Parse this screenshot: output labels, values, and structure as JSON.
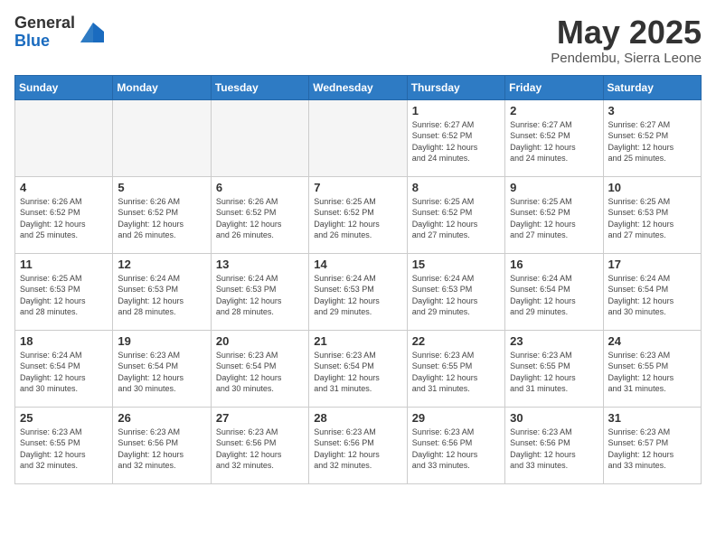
{
  "header": {
    "logo_general": "General",
    "logo_blue": "Blue",
    "month_year": "May 2025",
    "location": "Pendembu, Sierra Leone"
  },
  "weekdays": [
    "Sunday",
    "Monday",
    "Tuesday",
    "Wednesday",
    "Thursday",
    "Friday",
    "Saturday"
  ],
  "weeks": [
    [
      {
        "day": "",
        "info": ""
      },
      {
        "day": "",
        "info": ""
      },
      {
        "day": "",
        "info": ""
      },
      {
        "day": "",
        "info": ""
      },
      {
        "day": "1",
        "info": "Sunrise: 6:27 AM\nSunset: 6:52 PM\nDaylight: 12 hours\nand 24 minutes."
      },
      {
        "day": "2",
        "info": "Sunrise: 6:27 AM\nSunset: 6:52 PM\nDaylight: 12 hours\nand 24 minutes."
      },
      {
        "day": "3",
        "info": "Sunrise: 6:27 AM\nSunset: 6:52 PM\nDaylight: 12 hours\nand 25 minutes."
      }
    ],
    [
      {
        "day": "4",
        "info": "Sunrise: 6:26 AM\nSunset: 6:52 PM\nDaylight: 12 hours\nand 25 minutes."
      },
      {
        "day": "5",
        "info": "Sunrise: 6:26 AM\nSunset: 6:52 PM\nDaylight: 12 hours\nand 26 minutes."
      },
      {
        "day": "6",
        "info": "Sunrise: 6:26 AM\nSunset: 6:52 PM\nDaylight: 12 hours\nand 26 minutes."
      },
      {
        "day": "7",
        "info": "Sunrise: 6:25 AM\nSunset: 6:52 PM\nDaylight: 12 hours\nand 26 minutes."
      },
      {
        "day": "8",
        "info": "Sunrise: 6:25 AM\nSunset: 6:52 PM\nDaylight: 12 hours\nand 27 minutes."
      },
      {
        "day": "9",
        "info": "Sunrise: 6:25 AM\nSunset: 6:52 PM\nDaylight: 12 hours\nand 27 minutes."
      },
      {
        "day": "10",
        "info": "Sunrise: 6:25 AM\nSunset: 6:53 PM\nDaylight: 12 hours\nand 27 minutes."
      }
    ],
    [
      {
        "day": "11",
        "info": "Sunrise: 6:25 AM\nSunset: 6:53 PM\nDaylight: 12 hours\nand 28 minutes."
      },
      {
        "day": "12",
        "info": "Sunrise: 6:24 AM\nSunset: 6:53 PM\nDaylight: 12 hours\nand 28 minutes."
      },
      {
        "day": "13",
        "info": "Sunrise: 6:24 AM\nSunset: 6:53 PM\nDaylight: 12 hours\nand 28 minutes."
      },
      {
        "day": "14",
        "info": "Sunrise: 6:24 AM\nSunset: 6:53 PM\nDaylight: 12 hours\nand 29 minutes."
      },
      {
        "day": "15",
        "info": "Sunrise: 6:24 AM\nSunset: 6:53 PM\nDaylight: 12 hours\nand 29 minutes."
      },
      {
        "day": "16",
        "info": "Sunrise: 6:24 AM\nSunset: 6:54 PM\nDaylight: 12 hours\nand 29 minutes."
      },
      {
        "day": "17",
        "info": "Sunrise: 6:24 AM\nSunset: 6:54 PM\nDaylight: 12 hours\nand 30 minutes."
      }
    ],
    [
      {
        "day": "18",
        "info": "Sunrise: 6:24 AM\nSunset: 6:54 PM\nDaylight: 12 hours\nand 30 minutes."
      },
      {
        "day": "19",
        "info": "Sunrise: 6:23 AM\nSunset: 6:54 PM\nDaylight: 12 hours\nand 30 minutes."
      },
      {
        "day": "20",
        "info": "Sunrise: 6:23 AM\nSunset: 6:54 PM\nDaylight: 12 hours\nand 30 minutes."
      },
      {
        "day": "21",
        "info": "Sunrise: 6:23 AM\nSunset: 6:54 PM\nDaylight: 12 hours\nand 31 minutes."
      },
      {
        "day": "22",
        "info": "Sunrise: 6:23 AM\nSunset: 6:55 PM\nDaylight: 12 hours\nand 31 minutes."
      },
      {
        "day": "23",
        "info": "Sunrise: 6:23 AM\nSunset: 6:55 PM\nDaylight: 12 hours\nand 31 minutes."
      },
      {
        "day": "24",
        "info": "Sunrise: 6:23 AM\nSunset: 6:55 PM\nDaylight: 12 hours\nand 31 minutes."
      }
    ],
    [
      {
        "day": "25",
        "info": "Sunrise: 6:23 AM\nSunset: 6:55 PM\nDaylight: 12 hours\nand 32 minutes."
      },
      {
        "day": "26",
        "info": "Sunrise: 6:23 AM\nSunset: 6:56 PM\nDaylight: 12 hours\nand 32 minutes."
      },
      {
        "day": "27",
        "info": "Sunrise: 6:23 AM\nSunset: 6:56 PM\nDaylight: 12 hours\nand 32 minutes."
      },
      {
        "day": "28",
        "info": "Sunrise: 6:23 AM\nSunset: 6:56 PM\nDaylight: 12 hours\nand 32 minutes."
      },
      {
        "day": "29",
        "info": "Sunrise: 6:23 AM\nSunset: 6:56 PM\nDaylight: 12 hours\nand 33 minutes."
      },
      {
        "day": "30",
        "info": "Sunrise: 6:23 AM\nSunset: 6:56 PM\nDaylight: 12 hours\nand 33 minutes."
      },
      {
        "day": "31",
        "info": "Sunrise: 6:23 AM\nSunset: 6:57 PM\nDaylight: 12 hours\nand 33 minutes."
      }
    ]
  ]
}
